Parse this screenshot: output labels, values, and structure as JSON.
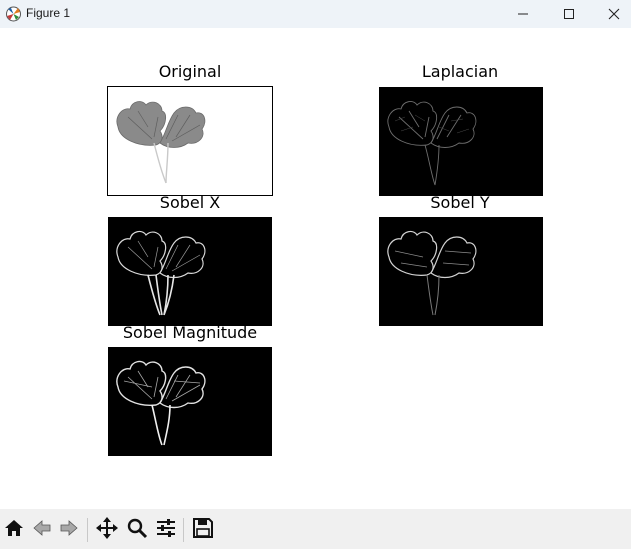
{
  "window": {
    "title": "Figure 1",
    "icons": [
      "matplotlib-icon",
      "minimize-icon",
      "maximize-icon",
      "close-icon"
    ]
  },
  "figure": {
    "subplots": [
      {
        "title": "Original",
        "kind": "grayscale-leaf"
      },
      {
        "title": "Laplacian",
        "kind": "edge-map"
      },
      {
        "title": "Sobel X",
        "kind": "edge-map"
      },
      {
        "title": "Sobel Y",
        "kind": "edge-map"
      },
      {
        "title": "Sobel Magnitude",
        "kind": "edge-map"
      }
    ]
  },
  "toolbar": {
    "tools": [
      "home-icon",
      "back-icon",
      "forward-icon",
      "pan-icon",
      "zoom-icon",
      "configure-subplots-icon",
      "save-icon"
    ]
  },
  "colors": {
    "titlebar": "#eef3f8",
    "toolbar": "#f0f0f0",
    "panel_background": "#000000"
  }
}
